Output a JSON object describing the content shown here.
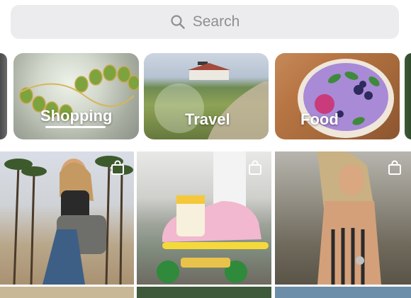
{
  "search": {
    "placeholder": "Search"
  },
  "categories": [
    {
      "label": "Shopping"
    },
    {
      "label": "Travel"
    },
    {
      "label": "Food"
    }
  ],
  "feed": {
    "items": [
      {
        "image": "woman-with-backpack-photo",
        "badge_icon": "shopping-bag-icon"
      },
      {
        "image": "pink-shoe-on-skateboard-photo",
        "badge_icon": "shopping-bag-icon"
      },
      {
        "image": "woman-in-striped-dress-photo",
        "badge_icon": "shopping-bag-icon"
      }
    ]
  },
  "colors": {
    "search_bg": "#ececee",
    "search_text": "#8e8e93",
    "label_text": "#ffffff"
  }
}
